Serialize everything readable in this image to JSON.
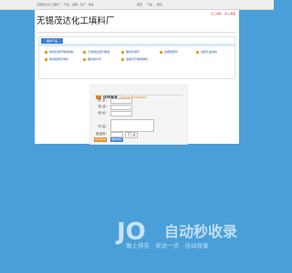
{
  "topbar": {
    "left_text": "无锡茂达化工填料厂 - 产品 - 说明 - 生产 - 联系",
    "links": [
      "首页",
      "产品",
      "联系"
    ]
  },
  "header": {
    "title": "无锡茂达化工填料厂",
    "links": "化工填料 · 加入收藏"
  },
  "products": {
    "tab_label": "填料产品",
    "items": [
      "陶瓷阶梯环散堆填料",
      "不锈钢拉西环散堆",
      "塑料阶梯环",
      "金属矩鞍环",
      "瓷质孔板波纹",
      "陶瓷矩鞍环填料",
      "塑料鲍尔环",
      "金属花环散堆填料"
    ]
  },
  "form": {
    "title": "在线留言",
    "title_en": "Online Messages",
    "fields": {
      "name": "姓  名：",
      "phone": "电  话：",
      "address": "地  址：",
      "content": "内  容：",
      "captcha": "验证码："
    },
    "captcha_value": "7 j 8",
    "submit_label": "提交留言",
    "reset_label": "重新填写"
  },
  "watermark": {
    "logo": "JO",
    "main": "自动秒收录",
    "sub": "做上排名 · 来访一点 · 自动收录"
  }
}
